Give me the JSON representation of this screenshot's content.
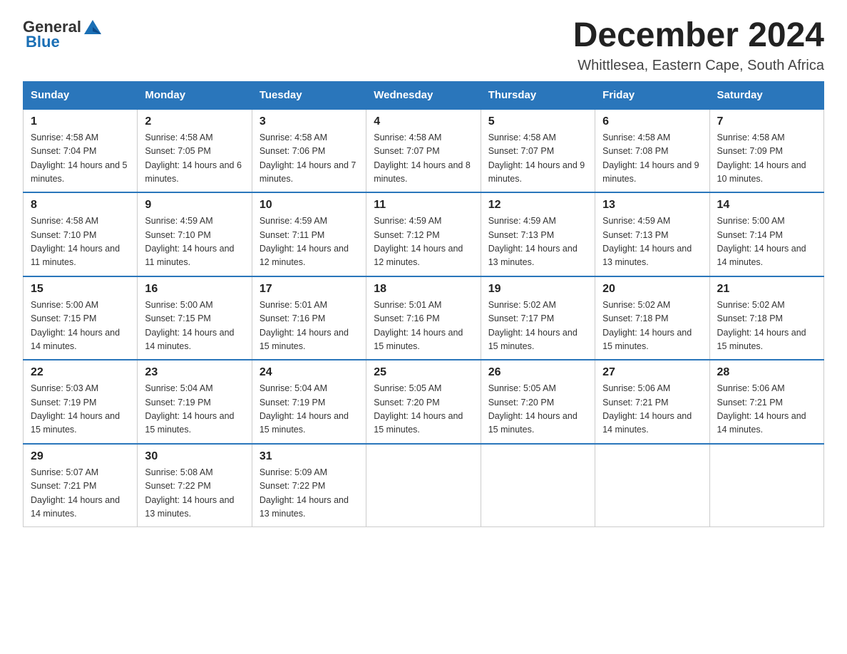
{
  "header": {
    "logo_general": "General",
    "logo_blue": "Blue",
    "month_title": "December 2024",
    "location": "Whittlesea, Eastern Cape, South Africa"
  },
  "weekdays": [
    "Sunday",
    "Monday",
    "Tuesday",
    "Wednesday",
    "Thursday",
    "Friday",
    "Saturday"
  ],
  "weeks": [
    [
      {
        "day": "1",
        "sunrise": "4:58 AM",
        "sunset": "7:04 PM",
        "daylight": "14 hours and 5 minutes."
      },
      {
        "day": "2",
        "sunrise": "4:58 AM",
        "sunset": "7:05 PM",
        "daylight": "14 hours and 6 minutes."
      },
      {
        "day": "3",
        "sunrise": "4:58 AM",
        "sunset": "7:06 PM",
        "daylight": "14 hours and 7 minutes."
      },
      {
        "day": "4",
        "sunrise": "4:58 AM",
        "sunset": "7:07 PM",
        "daylight": "14 hours and 8 minutes."
      },
      {
        "day": "5",
        "sunrise": "4:58 AM",
        "sunset": "7:07 PM",
        "daylight": "14 hours and 9 minutes."
      },
      {
        "day": "6",
        "sunrise": "4:58 AM",
        "sunset": "7:08 PM",
        "daylight": "14 hours and 9 minutes."
      },
      {
        "day": "7",
        "sunrise": "4:58 AM",
        "sunset": "7:09 PM",
        "daylight": "14 hours and 10 minutes."
      }
    ],
    [
      {
        "day": "8",
        "sunrise": "4:58 AM",
        "sunset": "7:10 PM",
        "daylight": "14 hours and 11 minutes."
      },
      {
        "day": "9",
        "sunrise": "4:59 AM",
        "sunset": "7:10 PM",
        "daylight": "14 hours and 11 minutes."
      },
      {
        "day": "10",
        "sunrise": "4:59 AM",
        "sunset": "7:11 PM",
        "daylight": "14 hours and 12 minutes."
      },
      {
        "day": "11",
        "sunrise": "4:59 AM",
        "sunset": "7:12 PM",
        "daylight": "14 hours and 12 minutes."
      },
      {
        "day": "12",
        "sunrise": "4:59 AM",
        "sunset": "7:13 PM",
        "daylight": "14 hours and 13 minutes."
      },
      {
        "day": "13",
        "sunrise": "4:59 AM",
        "sunset": "7:13 PM",
        "daylight": "14 hours and 13 minutes."
      },
      {
        "day": "14",
        "sunrise": "5:00 AM",
        "sunset": "7:14 PM",
        "daylight": "14 hours and 14 minutes."
      }
    ],
    [
      {
        "day": "15",
        "sunrise": "5:00 AM",
        "sunset": "7:15 PM",
        "daylight": "14 hours and 14 minutes."
      },
      {
        "day": "16",
        "sunrise": "5:00 AM",
        "sunset": "7:15 PM",
        "daylight": "14 hours and 14 minutes."
      },
      {
        "day": "17",
        "sunrise": "5:01 AM",
        "sunset": "7:16 PM",
        "daylight": "14 hours and 15 minutes."
      },
      {
        "day": "18",
        "sunrise": "5:01 AM",
        "sunset": "7:16 PM",
        "daylight": "14 hours and 15 minutes."
      },
      {
        "day": "19",
        "sunrise": "5:02 AM",
        "sunset": "7:17 PM",
        "daylight": "14 hours and 15 minutes."
      },
      {
        "day": "20",
        "sunrise": "5:02 AM",
        "sunset": "7:18 PM",
        "daylight": "14 hours and 15 minutes."
      },
      {
        "day": "21",
        "sunrise": "5:02 AM",
        "sunset": "7:18 PM",
        "daylight": "14 hours and 15 minutes."
      }
    ],
    [
      {
        "day": "22",
        "sunrise": "5:03 AM",
        "sunset": "7:19 PM",
        "daylight": "14 hours and 15 minutes."
      },
      {
        "day": "23",
        "sunrise": "5:04 AM",
        "sunset": "7:19 PM",
        "daylight": "14 hours and 15 minutes."
      },
      {
        "day": "24",
        "sunrise": "5:04 AM",
        "sunset": "7:19 PM",
        "daylight": "14 hours and 15 minutes."
      },
      {
        "day": "25",
        "sunrise": "5:05 AM",
        "sunset": "7:20 PM",
        "daylight": "14 hours and 15 minutes."
      },
      {
        "day": "26",
        "sunrise": "5:05 AM",
        "sunset": "7:20 PM",
        "daylight": "14 hours and 15 minutes."
      },
      {
        "day": "27",
        "sunrise": "5:06 AM",
        "sunset": "7:21 PM",
        "daylight": "14 hours and 14 minutes."
      },
      {
        "day": "28",
        "sunrise": "5:06 AM",
        "sunset": "7:21 PM",
        "daylight": "14 hours and 14 minutes."
      }
    ],
    [
      {
        "day": "29",
        "sunrise": "5:07 AM",
        "sunset": "7:21 PM",
        "daylight": "14 hours and 14 minutes."
      },
      {
        "day": "30",
        "sunrise": "5:08 AM",
        "sunset": "7:22 PM",
        "daylight": "14 hours and 13 minutes."
      },
      {
        "day": "31",
        "sunrise": "5:09 AM",
        "sunset": "7:22 PM",
        "daylight": "14 hours and 13 minutes."
      },
      null,
      null,
      null,
      null
    ]
  ]
}
